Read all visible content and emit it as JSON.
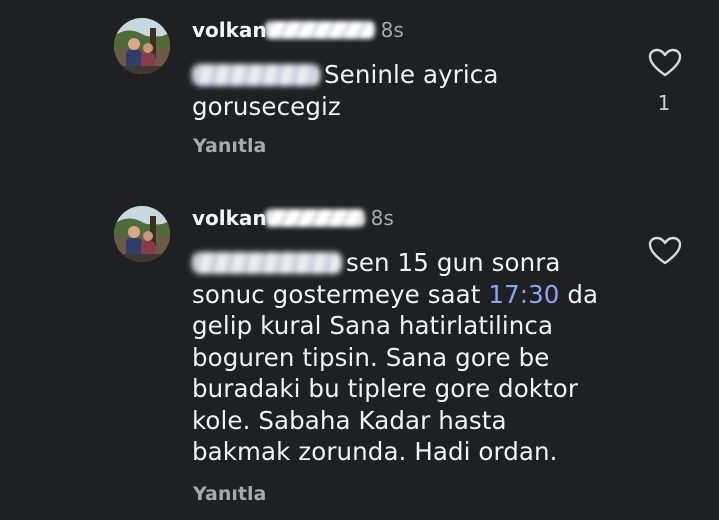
{
  "comments": [
    {
      "username": "volkan",
      "time": "8s",
      "text_lines": [
        "Seninle ayrica",
        "gorusecegiz"
      ],
      "reply_label": "Yanıtla",
      "like_count": "1",
      "icons": {
        "avatar": "user-avatar-photo",
        "like": "heart-icon"
      }
    },
    {
      "username": "volkan",
      "time": "8s",
      "text_part1": "sen 15 gun sonra",
      "text_part2": "sonuc gostermeye saat ",
      "time_link": "17:30",
      "text_part3": " da",
      "text_lines_rest": [
        "gelip kural Sana hatirlatilinca",
        "boguren tipsin. Sana gore be",
        "buradaki bu tiplere gore doktor",
        "kole. Sabaha Kadar hasta",
        "bakmak zorunda. Hadi ordan."
      ],
      "reply_label": "Yanıtla",
      "icons": {
        "avatar": "user-avatar-photo",
        "like": "heart-icon"
      }
    }
  ],
  "colors": {
    "background": "#1f2024",
    "secondary_text": "#a8a8ae",
    "link": "#8ea4f2"
  }
}
